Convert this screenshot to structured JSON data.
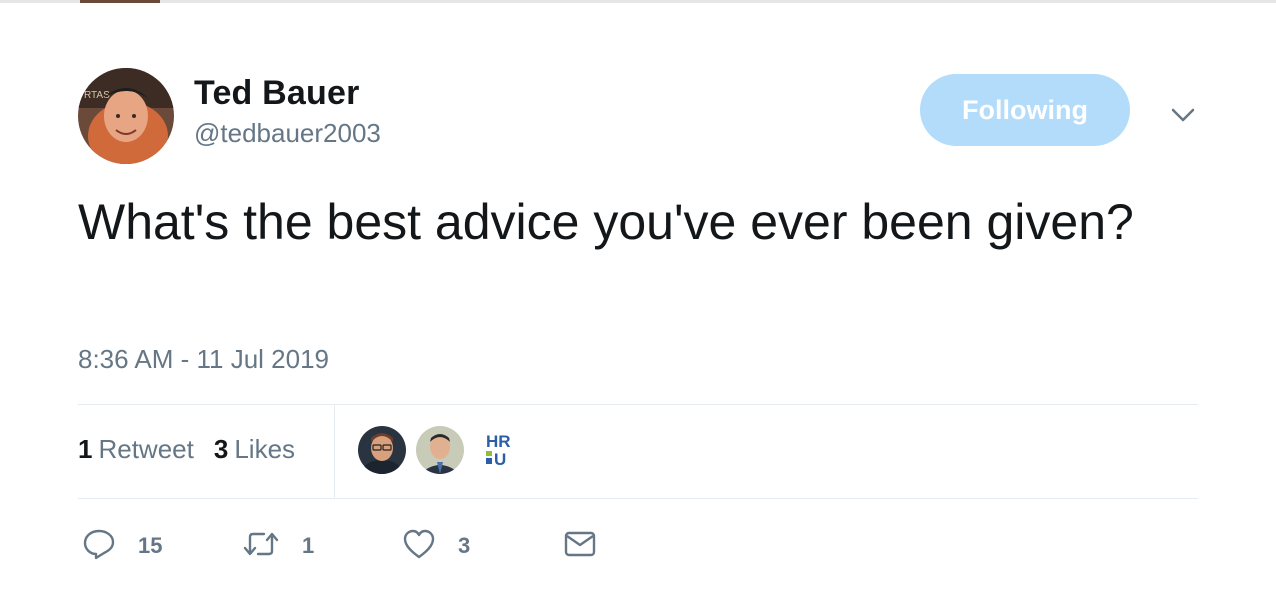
{
  "tweet": {
    "author": {
      "display_name": "Ted Bauer",
      "handle": "@tedbauer2003"
    },
    "follow_button_label": "Following",
    "text": "What's the best advice you've ever been given?",
    "timestamp": "8:36 AM - 11 Jul 2019",
    "stats": {
      "retweet_count": "1",
      "retweet_label": "Retweet",
      "like_count": "3",
      "like_label": "Likes"
    },
    "liker_avatars": [
      "avatar-man-glasses",
      "avatar-man-suit",
      "hrnu-logo"
    ],
    "actions": {
      "reply_count": "15",
      "retweet_count": "1",
      "like_count": "3"
    }
  },
  "colors": {
    "follow_button_bg": "#b3dbfa",
    "secondary_text": "#657786",
    "primary_text": "#14171a",
    "divider": "#e6ecf0"
  },
  "icons": [
    "chevron-down-icon",
    "reply-icon",
    "retweet-icon",
    "heart-icon",
    "envelope-icon"
  ]
}
